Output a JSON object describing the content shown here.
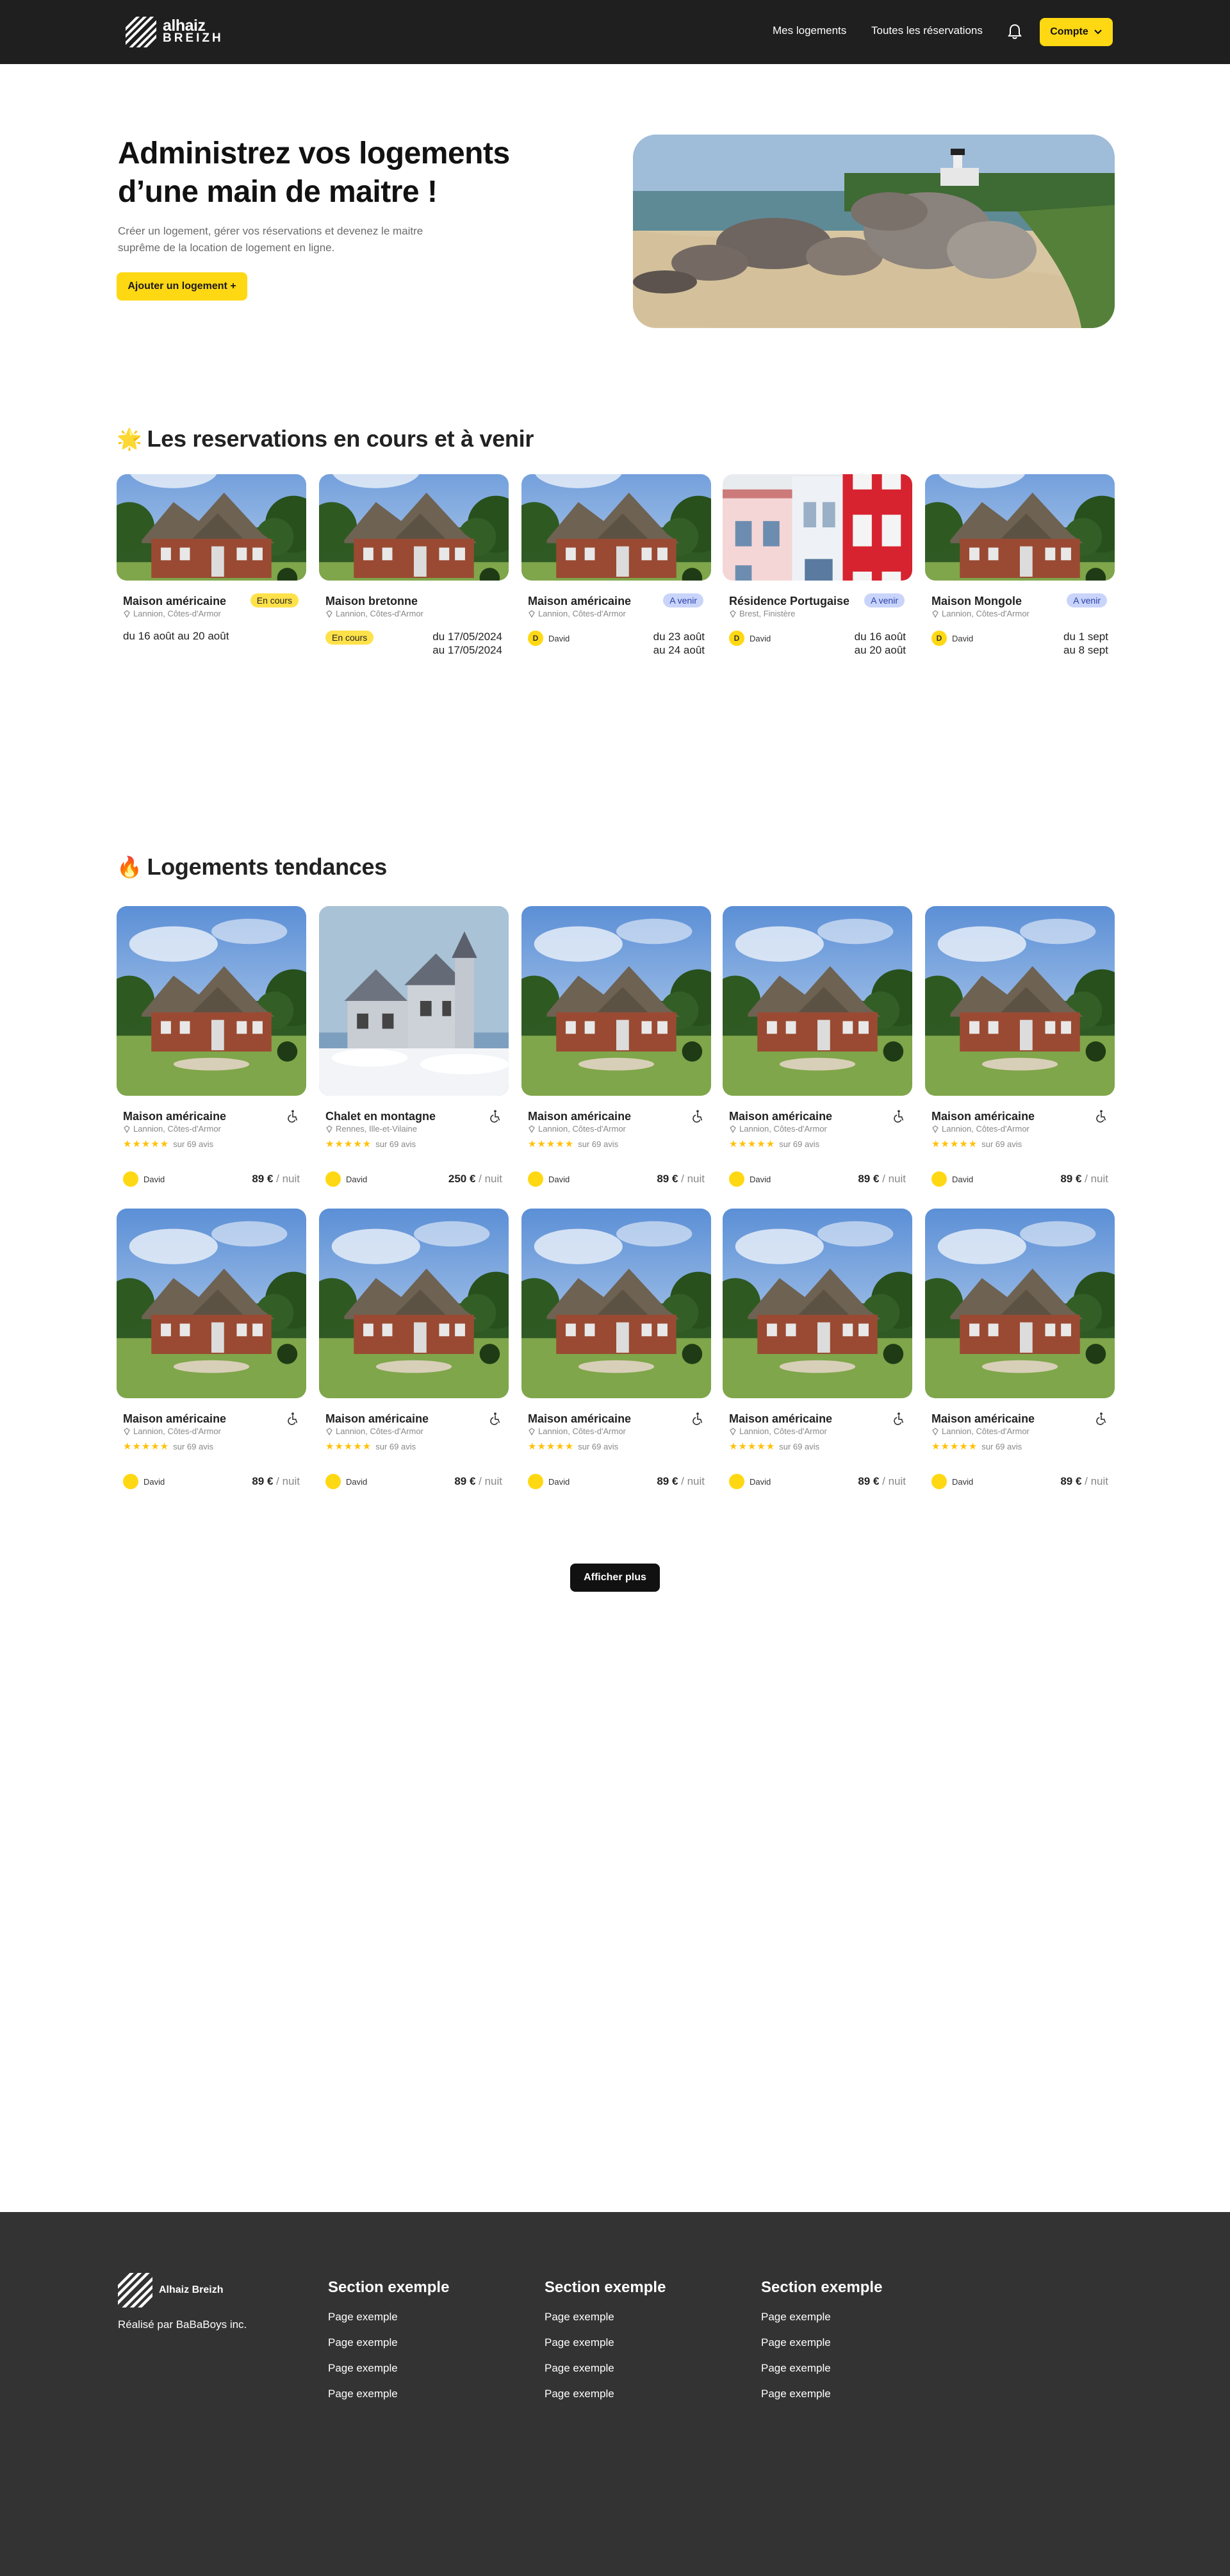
{
  "nav": {
    "brand_line1": "alhaiz",
    "brand_line2": "BREIZH",
    "link_logements": "Mes logements",
    "link_reservations": "Toutes les réservations",
    "account_label": "Compte",
    "accent_color": "#ffd814"
  },
  "hero": {
    "title": "Administrez vos logements d’une main de maitre !",
    "subtitle": "Créer un logement, gérer vos réservations et devenez le maitre suprême de la location de logement en ligne.",
    "add_button": "Ajouter un logement +"
  },
  "reservations": {
    "title": "Les reservations en cours et à venir",
    "emoji": "🌟",
    "items": [
      {
        "name": "Maison américaine",
        "location": "Lannion, Côtes-d'Armor",
        "status": "En cours",
        "dates": "du 16 août au 20 août"
      },
      {
        "name": "Maison bretonne",
        "location": "Lannion, Côtes-d'Armor",
        "status": "En cours",
        "date_line1": "du 17/05/2024",
        "date_line2": "au 17/05/2024"
      },
      {
        "name": "Maison américaine",
        "location": "Lannion, Côtes-d'Armor",
        "status": "A venir",
        "host": "David",
        "host_initial": "D",
        "date_line1": "du 23 août",
        "date_line2": "au 24 août"
      },
      {
        "name": "Résidence Portugaise",
        "location": "Brest, Finistère",
        "status": "A venir",
        "host": "David",
        "host_initial": "D",
        "date_line1": "du 16 août",
        "date_line2": "au 20 août"
      },
      {
        "name": "Maison Mongole",
        "location": "Lannion, Côtes-d'Armor",
        "status": "A venir",
        "host": "David",
        "host_initial": "D",
        "date_line1": "du 1 sept",
        "date_line2": "au 8 sept"
      }
    ]
  },
  "trending": {
    "title": "Logements tendances",
    "emoji": "🔥",
    "items": [
      {
        "name": "Maison américaine",
        "location": "Lannion, Côtes-d'Armor",
        "reviews": "sur 69 avis",
        "host": "David",
        "price": "89 €",
        "unit": " / nuit",
        "rating_stars": 5
      },
      {
        "name": "Chalet en montagne",
        "location": "Rennes, Ille-et-Vilaine",
        "reviews": "sur 69 avis",
        "host": "David",
        "price": "250 €",
        "unit": " / nuit",
        "rating_stars": 5
      },
      {
        "name": "Maison américaine",
        "location": "Lannion, Côtes-d'Armor",
        "reviews": "sur 69 avis",
        "host": "David",
        "price": "89 €",
        "unit": " / nuit",
        "rating_stars": 5
      },
      {
        "name": "Maison américaine",
        "location": "Lannion, Côtes-d'Armor",
        "reviews": "sur 69 avis",
        "host": "David",
        "price": "89 €",
        "unit": " / nuit",
        "rating_stars": 5
      },
      {
        "name": "Maison américaine",
        "location": "Lannion, Côtes-d'Armor",
        "reviews": "sur 69 avis",
        "host": "David",
        "price": "89 €",
        "unit": " / nuit",
        "rating_stars": 5
      },
      {
        "name": "Maison américaine",
        "location": "Lannion, Côtes-d'Armor",
        "reviews": "sur 69 avis",
        "host": "David",
        "price": "89 €",
        "unit": " / nuit",
        "rating_stars": 5
      },
      {
        "name": "Maison américaine",
        "location": "Lannion, Côtes-d'Armor",
        "reviews": "sur 69 avis",
        "host": "David",
        "price": "89 €",
        "unit": " / nuit",
        "rating_stars": 5
      },
      {
        "name": "Maison américaine",
        "location": "Lannion, Côtes-d'Armor",
        "reviews": "sur 69 avis",
        "host": "David",
        "price": "89 €",
        "unit": " / nuit",
        "rating_stars": 5
      },
      {
        "name": "Maison américaine",
        "location": "Lannion, Côtes-d'Armor",
        "reviews": "sur 69 avis",
        "host": "David",
        "price": "89 €",
        "unit": " / nuit",
        "rating_stars": 5
      },
      {
        "name": "Maison américaine",
        "location": "Lannion, Côtes-d'Armor",
        "reviews": "sur 69 avis",
        "host": "David",
        "price": "89 €",
        "unit": " / nuit",
        "rating_stars": 5
      }
    ],
    "more_button": "Afficher plus"
  },
  "footer": {
    "brand": "Alhaiz Breizh",
    "made_by": "Réalisé par BaBaBoys inc.",
    "columns": [
      {
        "title": "Section exemple",
        "links": [
          "Page exemple",
          "Page exemple",
          "Page exemple",
          "Page exemple"
        ]
      },
      {
        "title": "Section exemple",
        "links": [
          "Page exemple",
          "Page exemple",
          "Page exemple",
          "Page exemple"
        ]
      },
      {
        "title": "Section exemple",
        "links": [
          "Page exemple",
          "Page exemple",
          "Page exemple",
          "Page exemple"
        ]
      }
    ]
  }
}
